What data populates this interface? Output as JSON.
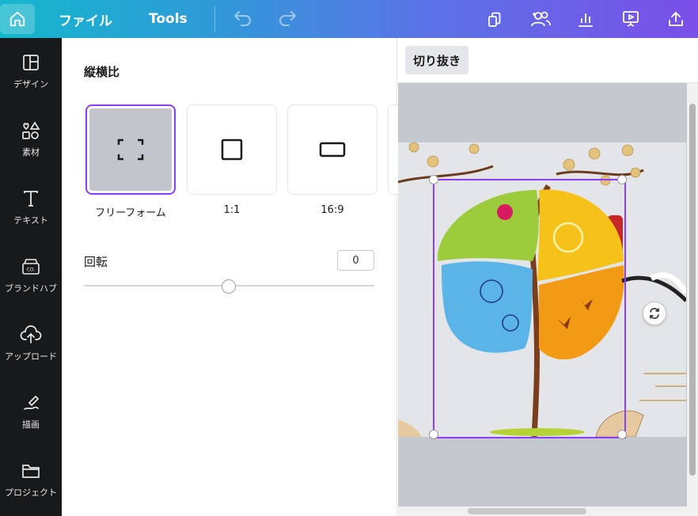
{
  "topbar": {
    "menu_file": "ファイル",
    "menu_tools": "Tools",
    "icons": [
      "home-icon",
      "undo-icon",
      "redo-icon",
      "resize-icon",
      "share-people-icon",
      "insights-icon",
      "present-icon",
      "upload-share-icon"
    ]
  },
  "sidebar": {
    "items": [
      {
        "label": "デザイン",
        "icon": "layout-icon"
      },
      {
        "label": "素材",
        "icon": "elements-icon"
      },
      {
        "label": "テキスト",
        "icon": "text-icon"
      },
      {
        "label": "ブランドハブ",
        "icon": "brand-hub-icon"
      },
      {
        "label": "アップロード",
        "icon": "upload-icon"
      },
      {
        "label": "描画",
        "icon": "draw-icon"
      },
      {
        "label": "プロジェクト",
        "icon": "folder-icon"
      }
    ]
  },
  "panel": {
    "aspect_title": "縦横比",
    "ratios": [
      {
        "label": "フリーフォーム",
        "selected": true
      },
      {
        "label": "1:1",
        "selected": false
      },
      {
        "label": "16:9",
        "selected": false
      }
    ],
    "rotate_label": "回転",
    "rotate_value": "0",
    "rotate_slider_fraction": 0.5
  },
  "canvas": {
    "crop_button": "切り抜き"
  },
  "colors": {
    "accent": "#8b3dff",
    "sidebar_bg": "#18191b",
    "canvas_bg": "#c4c8cf"
  }
}
